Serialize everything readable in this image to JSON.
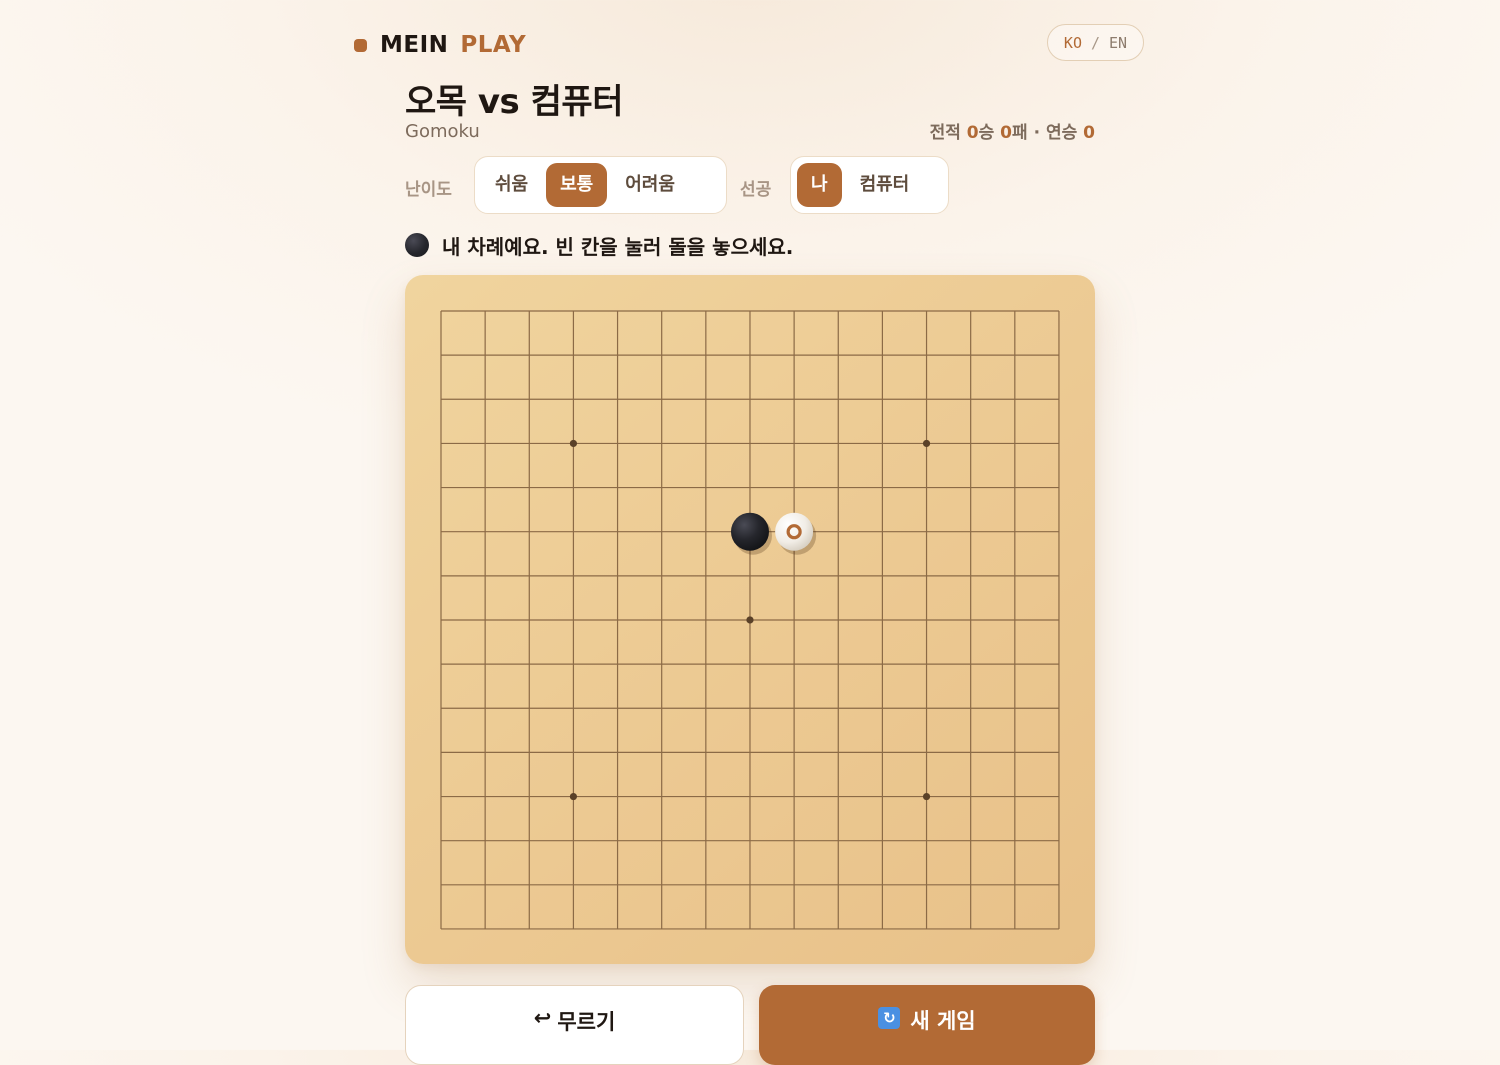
{
  "header": {
    "logo_part1": "MEIN",
    "logo_part2": "PLAY",
    "lang_ko": "KO",
    "lang_sep": "/",
    "lang_en": "EN"
  },
  "game": {
    "title": "오목 vs 컴퓨터",
    "subtitle": "Gomoku"
  },
  "record": {
    "prefix": "전적 ",
    "wins": "0",
    "wins_suffix": "승 ",
    "losses": "0",
    "losses_suffix": "패 · 연승 ",
    "streak": "0"
  },
  "difficulty": {
    "label": "난이도",
    "options": [
      "쉬움",
      "보통",
      "어려움"
    ],
    "selected": "보통"
  },
  "first_move": {
    "label": "선공",
    "options": [
      "나",
      "컴퓨터"
    ],
    "selected": "나"
  },
  "status": {
    "text": "내 차례예요. 빈 칸을 눌러 돌을 놓으세요."
  },
  "board": {
    "size": 15,
    "star_points": [
      [
        3,
        3
      ],
      [
        3,
        11
      ],
      [
        7,
        7
      ],
      [
        11,
        3
      ],
      [
        11,
        11
      ]
    ],
    "stones": [
      {
        "row": 5,
        "col": 7,
        "color": "black",
        "last": false
      },
      {
        "row": 5,
        "col": 8,
        "color": "white",
        "last": true
      }
    ]
  },
  "buttons": {
    "undo_icon": "↩",
    "undo_label": "무르기",
    "new_icon": "🔄",
    "new_label": "새 게임"
  },
  "colors": {
    "accent": "#b26a35",
    "board_light": "#f0d49e",
    "board_dark": "#e8c189",
    "grid_line": "#8b6a46"
  }
}
